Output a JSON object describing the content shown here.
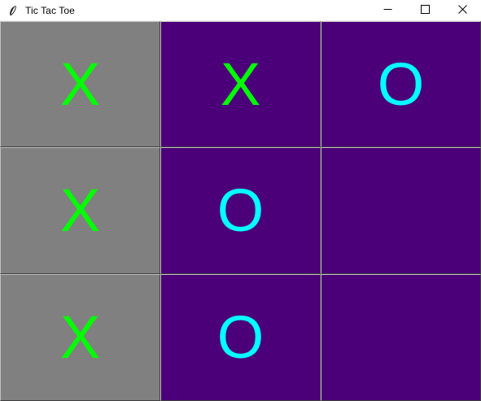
{
  "window": {
    "title": "Tic Tac Toe",
    "app_icon": "feather-icon",
    "controls": [
      "minimize-icon",
      "maximize-icon",
      "close-icon"
    ]
  },
  "colors": {
    "win_highlight": "#808080",
    "cell_bg": "#4b0079",
    "x_color": "#00ff00",
    "o_color": "#00ffff"
  },
  "board": {
    "rows": [
      [
        {
          "mark": "X",
          "highlight": true
        },
        {
          "mark": "X",
          "highlight": false
        },
        {
          "mark": "O",
          "highlight": false
        }
      ],
      [
        {
          "mark": "X",
          "highlight": true
        },
        {
          "mark": "O",
          "highlight": false
        },
        {
          "mark": "",
          "highlight": false
        }
      ],
      [
        {
          "mark": "X",
          "highlight": true
        },
        {
          "mark": "O",
          "highlight": false
        },
        {
          "mark": "",
          "highlight": false
        }
      ]
    ]
  }
}
